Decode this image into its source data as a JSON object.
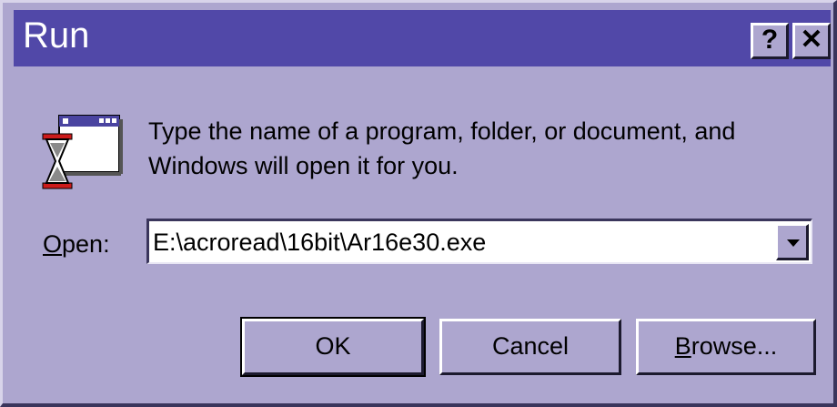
{
  "window": {
    "title": "Run",
    "help_label": "?",
    "close_label": "✕"
  },
  "icon": "run-program-icon",
  "message": {
    "line1": "Type the name of a program, folder, or document, and",
    "line2": "Windows will open it for you."
  },
  "open_field": {
    "label_mnemonic": "O",
    "label_rest": "pen:",
    "value": "E:\\acroread\\16bit\\Ar16e30.exe"
  },
  "buttons": {
    "ok": "OK",
    "cancel": "Cancel",
    "browse_mnemonic": "B",
    "browse_rest": "rowse..."
  },
  "colors": {
    "dialog_bg": "#ada6cf",
    "titlebar_bg": "#5148a8",
    "title_text": "#ffffff"
  }
}
